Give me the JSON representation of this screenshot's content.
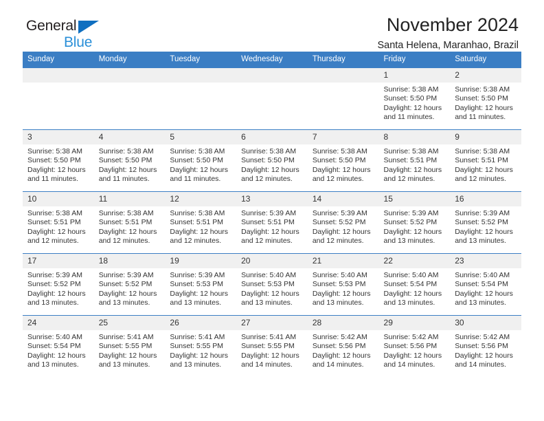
{
  "brand": {
    "line1": "General",
    "line2": "Blue",
    "triangle_color": "#0f6fc0",
    "text_color": "#231f20",
    "blue_text_color": "#2a8fd8"
  },
  "header": {
    "title": "November 2024",
    "subtitle": "Santa Helena, Maranhao, Brazil"
  },
  "theme": {
    "header_bg": "#3b7ec4",
    "daynum_bg": "#f0f0f0",
    "grid_line": "#3b7ec4",
    "text": "#333333"
  },
  "weekday_headers": [
    "Sunday",
    "Monday",
    "Tuesday",
    "Wednesday",
    "Thursday",
    "Friday",
    "Saturday"
  ],
  "weeks": [
    [
      {
        "day": "",
        "sunrise": "",
        "sunset": "",
        "daylight": ""
      },
      {
        "day": "",
        "sunrise": "",
        "sunset": "",
        "daylight": ""
      },
      {
        "day": "",
        "sunrise": "",
        "sunset": "",
        "daylight": ""
      },
      {
        "day": "",
        "sunrise": "",
        "sunset": "",
        "daylight": ""
      },
      {
        "day": "",
        "sunrise": "",
        "sunset": "",
        "daylight": ""
      },
      {
        "day": "1",
        "sunrise": "Sunrise: 5:38 AM",
        "sunset": "Sunset: 5:50 PM",
        "daylight": "Daylight: 12 hours and 11 minutes."
      },
      {
        "day": "2",
        "sunrise": "Sunrise: 5:38 AM",
        "sunset": "Sunset: 5:50 PM",
        "daylight": "Daylight: 12 hours and 11 minutes."
      }
    ],
    [
      {
        "day": "3",
        "sunrise": "Sunrise: 5:38 AM",
        "sunset": "Sunset: 5:50 PM",
        "daylight": "Daylight: 12 hours and 11 minutes."
      },
      {
        "day": "4",
        "sunrise": "Sunrise: 5:38 AM",
        "sunset": "Sunset: 5:50 PM",
        "daylight": "Daylight: 12 hours and 11 minutes."
      },
      {
        "day": "5",
        "sunrise": "Sunrise: 5:38 AM",
        "sunset": "Sunset: 5:50 PM",
        "daylight": "Daylight: 12 hours and 11 minutes."
      },
      {
        "day": "6",
        "sunrise": "Sunrise: 5:38 AM",
        "sunset": "Sunset: 5:50 PM",
        "daylight": "Daylight: 12 hours and 12 minutes."
      },
      {
        "day": "7",
        "sunrise": "Sunrise: 5:38 AM",
        "sunset": "Sunset: 5:50 PM",
        "daylight": "Daylight: 12 hours and 12 minutes."
      },
      {
        "day": "8",
        "sunrise": "Sunrise: 5:38 AM",
        "sunset": "Sunset: 5:51 PM",
        "daylight": "Daylight: 12 hours and 12 minutes."
      },
      {
        "day": "9",
        "sunrise": "Sunrise: 5:38 AM",
        "sunset": "Sunset: 5:51 PM",
        "daylight": "Daylight: 12 hours and 12 minutes."
      }
    ],
    [
      {
        "day": "10",
        "sunrise": "Sunrise: 5:38 AM",
        "sunset": "Sunset: 5:51 PM",
        "daylight": "Daylight: 12 hours and 12 minutes."
      },
      {
        "day": "11",
        "sunrise": "Sunrise: 5:38 AM",
        "sunset": "Sunset: 5:51 PM",
        "daylight": "Daylight: 12 hours and 12 minutes."
      },
      {
        "day": "12",
        "sunrise": "Sunrise: 5:38 AM",
        "sunset": "Sunset: 5:51 PM",
        "daylight": "Daylight: 12 hours and 12 minutes."
      },
      {
        "day": "13",
        "sunrise": "Sunrise: 5:39 AM",
        "sunset": "Sunset: 5:51 PM",
        "daylight": "Daylight: 12 hours and 12 minutes."
      },
      {
        "day": "14",
        "sunrise": "Sunrise: 5:39 AM",
        "sunset": "Sunset: 5:52 PM",
        "daylight": "Daylight: 12 hours and 12 minutes."
      },
      {
        "day": "15",
        "sunrise": "Sunrise: 5:39 AM",
        "sunset": "Sunset: 5:52 PM",
        "daylight": "Daylight: 12 hours and 13 minutes."
      },
      {
        "day": "16",
        "sunrise": "Sunrise: 5:39 AM",
        "sunset": "Sunset: 5:52 PM",
        "daylight": "Daylight: 12 hours and 13 minutes."
      }
    ],
    [
      {
        "day": "17",
        "sunrise": "Sunrise: 5:39 AM",
        "sunset": "Sunset: 5:52 PM",
        "daylight": "Daylight: 12 hours and 13 minutes."
      },
      {
        "day": "18",
        "sunrise": "Sunrise: 5:39 AM",
        "sunset": "Sunset: 5:52 PM",
        "daylight": "Daylight: 12 hours and 13 minutes."
      },
      {
        "day": "19",
        "sunrise": "Sunrise: 5:39 AM",
        "sunset": "Sunset: 5:53 PM",
        "daylight": "Daylight: 12 hours and 13 minutes."
      },
      {
        "day": "20",
        "sunrise": "Sunrise: 5:40 AM",
        "sunset": "Sunset: 5:53 PM",
        "daylight": "Daylight: 12 hours and 13 minutes."
      },
      {
        "day": "21",
        "sunrise": "Sunrise: 5:40 AM",
        "sunset": "Sunset: 5:53 PM",
        "daylight": "Daylight: 12 hours and 13 minutes."
      },
      {
        "day": "22",
        "sunrise": "Sunrise: 5:40 AM",
        "sunset": "Sunset: 5:54 PM",
        "daylight": "Daylight: 12 hours and 13 minutes."
      },
      {
        "day": "23",
        "sunrise": "Sunrise: 5:40 AM",
        "sunset": "Sunset: 5:54 PM",
        "daylight": "Daylight: 12 hours and 13 minutes."
      }
    ],
    [
      {
        "day": "24",
        "sunrise": "Sunrise: 5:40 AM",
        "sunset": "Sunset: 5:54 PM",
        "daylight": "Daylight: 12 hours and 13 minutes."
      },
      {
        "day": "25",
        "sunrise": "Sunrise: 5:41 AM",
        "sunset": "Sunset: 5:55 PM",
        "daylight": "Daylight: 12 hours and 13 minutes."
      },
      {
        "day": "26",
        "sunrise": "Sunrise: 5:41 AM",
        "sunset": "Sunset: 5:55 PM",
        "daylight": "Daylight: 12 hours and 13 minutes."
      },
      {
        "day": "27",
        "sunrise": "Sunrise: 5:41 AM",
        "sunset": "Sunset: 5:55 PM",
        "daylight": "Daylight: 12 hours and 14 minutes."
      },
      {
        "day": "28",
        "sunrise": "Sunrise: 5:42 AM",
        "sunset": "Sunset: 5:56 PM",
        "daylight": "Daylight: 12 hours and 14 minutes."
      },
      {
        "day": "29",
        "sunrise": "Sunrise: 5:42 AM",
        "sunset": "Sunset: 5:56 PM",
        "daylight": "Daylight: 12 hours and 14 minutes."
      },
      {
        "day": "30",
        "sunrise": "Sunrise: 5:42 AM",
        "sunset": "Sunset: 5:56 PM",
        "daylight": "Daylight: 12 hours and 14 minutes."
      }
    ]
  ]
}
